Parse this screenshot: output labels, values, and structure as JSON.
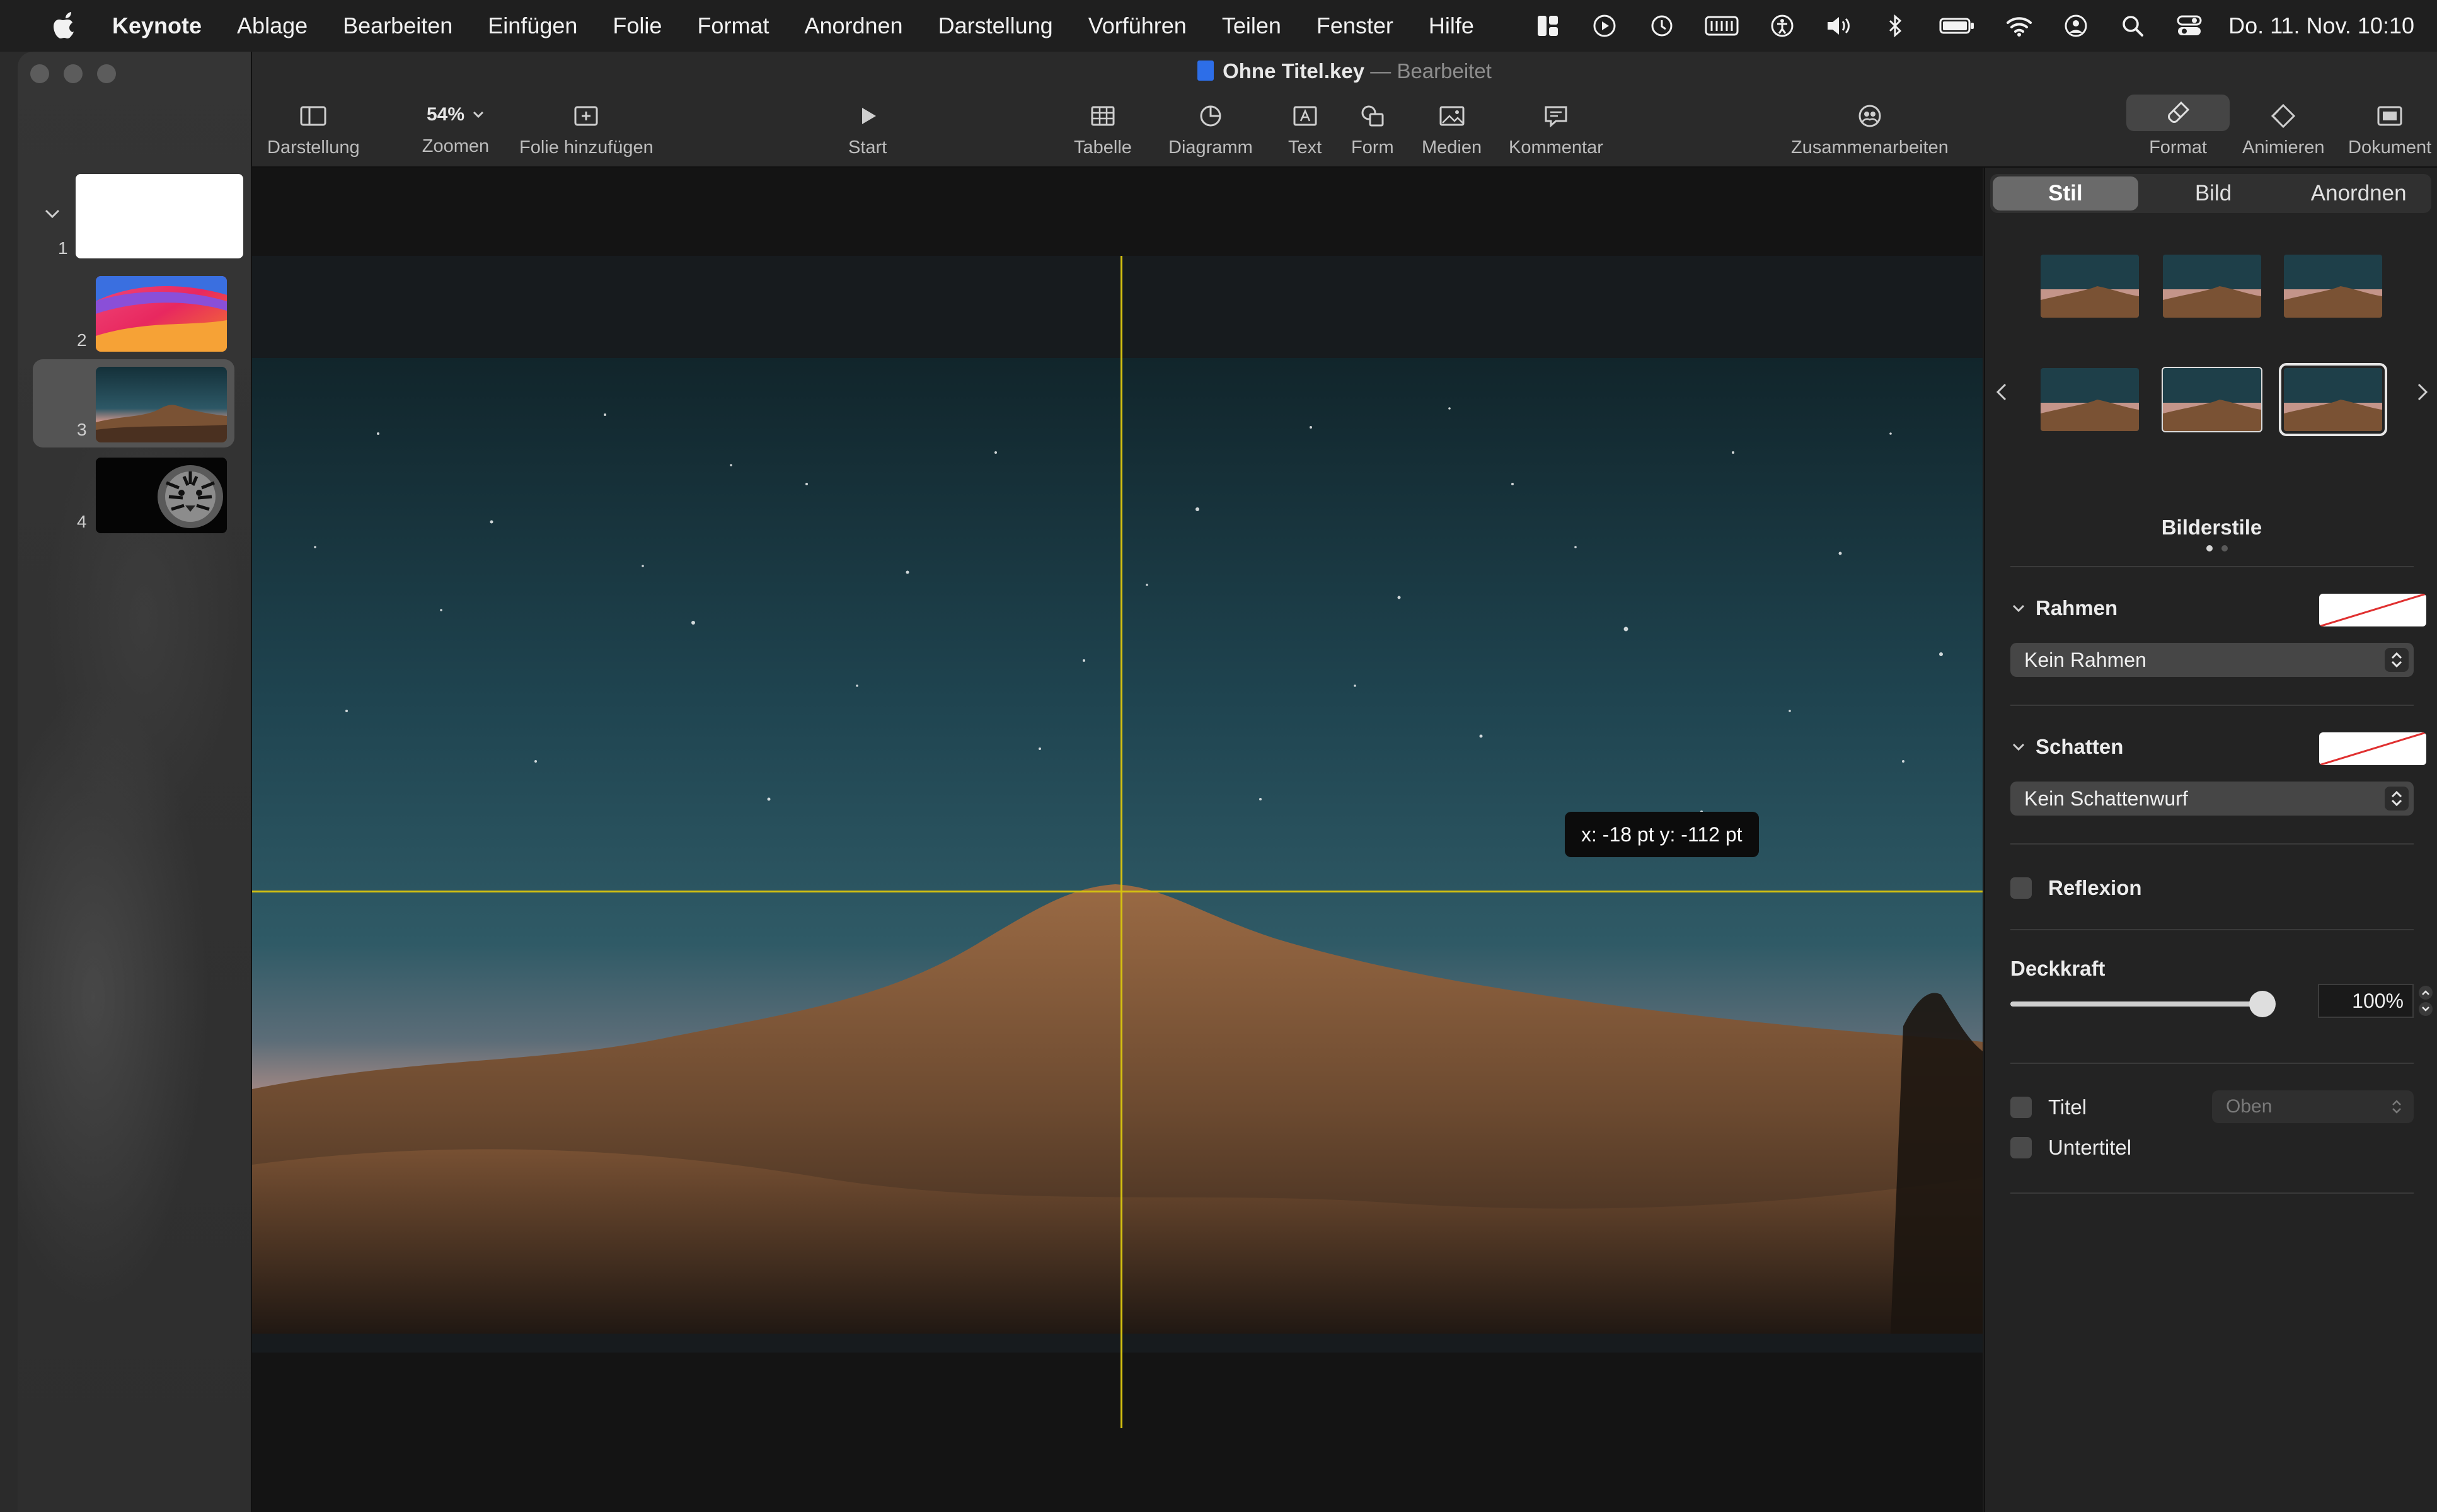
{
  "menubar": {
    "app": "Keynote",
    "menus": [
      "Ablage",
      "Bearbeiten",
      "Einfügen",
      "Folie",
      "Format",
      "Anordnen",
      "Darstellung",
      "Vorführen",
      "Teilen",
      "Fenster",
      "Hilfe"
    ],
    "clock": "Do. 11. Nov.  10:10",
    "status_icons": [
      "widget-icon",
      "play-circle-icon",
      "time-machine-icon",
      "keyboard-icon",
      "accessibility-icon",
      "volume-icon",
      "bluetooth-icon",
      "battery-icon",
      "wifi-icon",
      "user-icon",
      "search-icon",
      "control-center-icon"
    ]
  },
  "window": {
    "title": "Ohne Titel.key",
    "separator": "—",
    "subtitle": "Bearbeitet"
  },
  "toolbar": {
    "darstellung": "Darstellung",
    "zoom_value": "54%",
    "zoomen": "Zoomen",
    "add_slide": "Folie hinzufügen",
    "start": "Start",
    "tabelle": "Tabelle",
    "diagramm": "Diagramm",
    "text": "Text",
    "form": "Form",
    "medien": "Medien",
    "kommentar": "Kommentar",
    "zusammenarbeiten": "Zusammenarbeiten",
    "format": "Format",
    "animieren": "Animieren",
    "dokument": "Dokument"
  },
  "slides": [
    {
      "num": "1",
      "kind": "white"
    },
    {
      "num": "2",
      "kind": "gradient"
    },
    {
      "num": "3",
      "kind": "mountain",
      "selected": true
    },
    {
      "num": "4",
      "kind": "tiger"
    }
  ],
  "canvas": {
    "tooltip": "x: -18 pt  y: -112 pt"
  },
  "inspector": {
    "tabs": [
      "Stil",
      "Bild",
      "Anordnen"
    ],
    "selected_tab": "Stil",
    "bilderstile": "Bilderstile",
    "rahmen": "Rahmen",
    "rahmen_value": "Kein Rahmen",
    "schatten": "Schatten",
    "schatten_value": "Kein Schattenwurf",
    "reflexion": "Reflexion",
    "deckkraft": "Deckkraft",
    "deckkraft_value": "100%",
    "deckkraft_level": 1.0,
    "titel": "Titel",
    "titel_position": "Oben",
    "untertitel": "Untertitel"
  },
  "colors": {
    "guide": "#d6c20f",
    "accent": "#2d6ee8"
  }
}
